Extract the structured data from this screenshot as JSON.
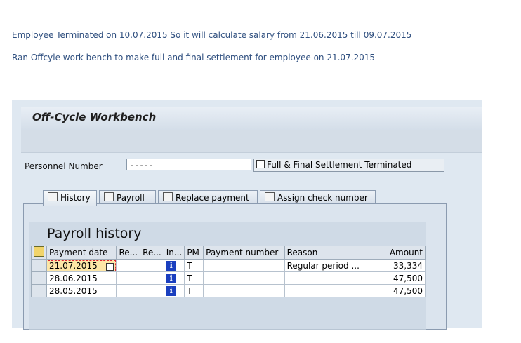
{
  "notes": {
    "line1": "Employee Terminated on 10.07.2015  So it will calculate salary from 21.06.2015 till 09.07.2015",
    "line2": "Ran Offcyle work bench to make full and final settlement for employee on 21.07.2015"
  },
  "window": {
    "title": "Off-Cycle Workbench"
  },
  "personnel": {
    "label": "Personnel Number",
    "value": "-----",
    "name_text": "Full & Final Settlement Terminated"
  },
  "tabs": [
    {
      "label": "History",
      "icon": "history-icon",
      "active": true
    },
    {
      "label": "Payroll",
      "icon": "calculator-icon"
    },
    {
      "label": "Replace payment",
      "icon": "replace-icon"
    },
    {
      "label": "Assign check number",
      "icon": "check-icon"
    }
  ],
  "history": {
    "title": "Payroll history",
    "columns": [
      "Payment date",
      "Re...",
      "Re...",
      "In...",
      "PM",
      "Payment number",
      "Reason",
      "Amount"
    ],
    "rows": [
      {
        "date": "21.07.2015",
        "pm": "T",
        "reason": "Regular period ...",
        "amount": "33,334"
      },
      {
        "date": "28.06.2015",
        "pm": "T",
        "reason": "",
        "amount": "47,500"
      },
      {
        "date": "28.05.2015",
        "pm": "T",
        "reason": "",
        "amount": "47,500"
      }
    ]
  }
}
